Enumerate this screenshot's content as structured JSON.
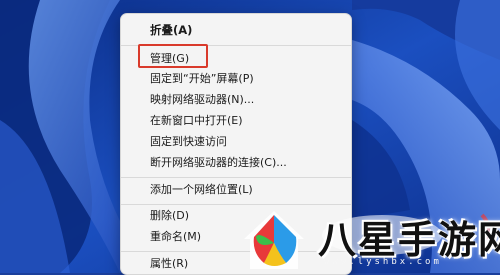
{
  "context_menu": {
    "items": [
      {
        "label": "折叠(A)",
        "bold": true
      },
      {
        "label": "管理(G)"
      },
      {
        "label": "固定到“开始”屏幕(P)"
      },
      {
        "label": "映射网络驱动器(N)..."
      },
      {
        "label": "在新窗口中打开(E)"
      },
      {
        "label": "固定到快速访问"
      },
      {
        "label": "断开网络驱动器的连接(C)..."
      },
      {
        "label": "添加一个网络位置(L)"
      },
      {
        "label": "删除(D)"
      },
      {
        "label": "重命名(M)"
      },
      {
        "label": "属性(R)"
      }
    ],
    "highlighted_item": "管理(G)",
    "highlight_color": "#d93a2b"
  },
  "watermark": {
    "brand": "八星手游网",
    "url": "www.lyshbx.com"
  },
  "colors": {
    "wallpaper_blue": "#1a3f9c",
    "menu_bg": "#f4f4f4"
  }
}
